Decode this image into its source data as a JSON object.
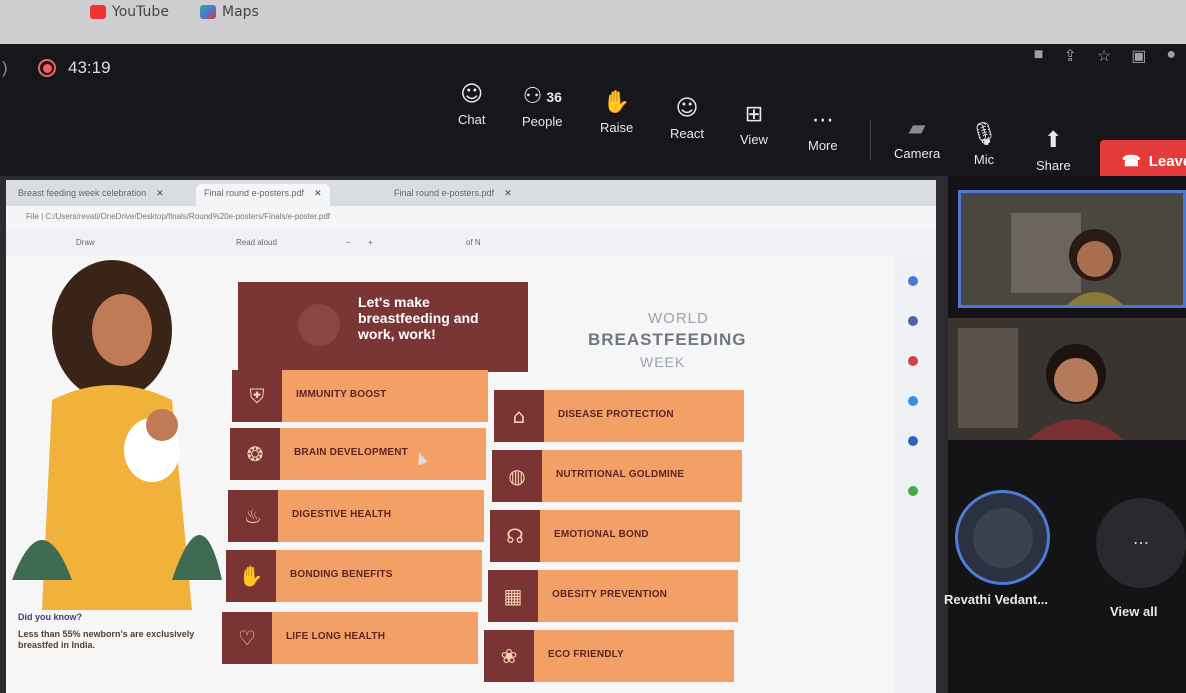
{
  "bookmarks": [
    {
      "label": "YouTube",
      "icon": "youtube-icon",
      "color": "#e33"
    },
    {
      "label": "Maps",
      "icon": "maps-icon",
      "color": "#3a8"
    }
  ],
  "browser_icons": [
    "camera-icon",
    "share-icon",
    "star-icon",
    "sidebar-icon",
    "profile-icon"
  ],
  "meeting": {
    "timer": "43:19",
    "controls": [
      {
        "label": "Chat",
        "icon": "chat-icon"
      },
      {
        "label": "People",
        "icon": "people-icon",
        "count": "36"
      },
      {
        "label": "Raise",
        "icon": "hand-icon"
      },
      {
        "label": "React",
        "icon": "smile-icon"
      },
      {
        "label": "View",
        "icon": "grid-icon"
      },
      {
        "label": "More",
        "icon": "more-icon"
      },
      {
        "label": "Camera",
        "icon": "camera-off-icon"
      },
      {
        "label": "Mic",
        "icon": "mic-off-icon"
      },
      {
        "label": "Share",
        "icon": "share-screen-icon"
      }
    ],
    "leave_label": "Leave"
  },
  "pdf": {
    "tabs": [
      {
        "label": "Breast feeding week celebration"
      },
      {
        "label": "Final round e-posters.pdf",
        "active": true
      },
      {
        "label": "Final round e-posters.pdf"
      }
    ],
    "address": "File | C:/Users/revati/OneDrive/Desktop/finals/Round%20e-posters/Finals/e-poster.pdf",
    "toolbar": {
      "draw": "Draw",
      "read_aloud": "Read aloud",
      "page": "of N",
      "zoom_minus": "−",
      "zoom_plus": "+"
    }
  },
  "poster": {
    "banner": "Let's make breastfeeding and work, work!",
    "brand": {
      "line1": "WORLD",
      "line2": "BREASTFEEDING",
      "line3": "WEEK"
    },
    "benefits_left": [
      {
        "label": "IMMUNITY BOOST",
        "icon": "shield-plus-icon"
      },
      {
        "label": "BRAIN DEVELOPMENT",
        "icon": "brain-icon"
      },
      {
        "label": "DIGESTIVE HEALTH",
        "icon": "digestive-icon"
      },
      {
        "label": "BONDING BENEFITS",
        "icon": "hand-heart-icon"
      },
      {
        "label": "LIFE LONG HEALTH",
        "icon": "heartbeat-icon"
      }
    ],
    "benefits_right": [
      {
        "label": "DISEASE PROTECTION",
        "icon": "house-heart-icon"
      },
      {
        "label": "NUTRITIONAL GOLDMINE",
        "icon": "apple-icon"
      },
      {
        "label": "EMOTIONAL BOND",
        "icon": "mother-child-icon"
      },
      {
        "label": "OBESITY PREVENTION",
        "icon": "scale-icon"
      },
      {
        "label": "ECO FRIENDLY",
        "icon": "globe-leaf-icon"
      }
    ],
    "did_you_know": "Did you know?",
    "fact": "Less than 55% newborn's are exclusively breastfed in India."
  },
  "participants": {
    "name": "Revathi Vedant...",
    "view_all": "View all"
  },
  "colors": {
    "card": "#f2a066",
    "icon_box": "#7b3434",
    "leave": "#e33b3b",
    "active_speaker": "#4a78d6"
  }
}
